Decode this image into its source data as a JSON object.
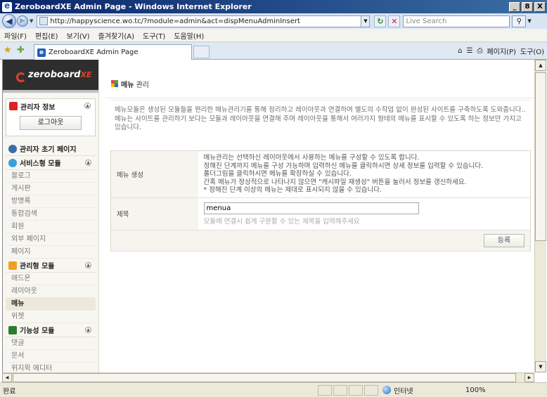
{
  "window": {
    "title": "ZeroboardXE Admin Page - Windows Internet Explorer",
    "minimize": "_",
    "maximize": "8",
    "close": "X"
  },
  "address": {
    "url": "http://happyscience.wo.tc/?module=admin&act=dispMenuAdminInsert",
    "search_placeholder": "Live Search"
  },
  "menu": [
    "파일(F)",
    "편집(E)",
    "보기(V)",
    "즐겨찾기(A)",
    "도구(T)",
    "도움말(H)"
  ],
  "tab": {
    "title": "ZeroboardXE Admin Page"
  },
  "commandbar": {
    "home": "⌂",
    "feeds": "☰",
    "print": "⎙",
    "page": "페이지(P)",
    "tools": "도구(O)"
  },
  "sidebar": {
    "logo": "zeroboard",
    "logo_suffix": "XE",
    "admin_info": "관리자 정보",
    "logout": "로그아웃",
    "admin_home": "관리자 초기 페이지",
    "service_modules": {
      "title": "서비스형 모듈",
      "items": [
        "블로그",
        "게시판",
        "방명록",
        "통합검색",
        "회원",
        "외부 페이지",
        "페이지"
      ]
    },
    "admin_modules": {
      "title": "관리형 모듈",
      "items": [
        "애드온",
        "레이아웃",
        "메뉴",
        "위젯"
      ]
    },
    "function_modules": {
      "title": "기능성 모듈",
      "items": [
        "댓글",
        "문서",
        "위지윅 에디터"
      ]
    }
  },
  "main": {
    "title_bold": "메뉴",
    "title_rest": " 관리",
    "desc_1": "메뉴모듈은 생성된 모듈들을 편리한 메뉴관리기를 통해 정리하고 레이아웃과 연결하여 별도의 수작업 없이 완성된 사이트를 구축하도록 도와줍니다..",
    "desc_2": "메뉴는 사이트를 관리하기 보다는 모듈과 레이아웃을 연결해 주며 레이아웃을 통해서 여러가지 형태의 메뉴를 표시할 수 있도록 하는 정보만 가지고 있습니다.",
    "row1_label": "메뉴 생성",
    "row1_lines": [
      "메뉴관리는 선택하신 레이아웃에서 사용하는 메뉴를 구성할 수 있도록 합니다.",
      "정해진 단계까지 메뉴를 구성 가능하며 입력하신 메뉴를 클릭하시면 상세 정보를 입력할 수 있습니다.",
      "폴더그림을 클릭하시면 메뉴를 확장하실 수 있습니다.",
      "간혹 메뉴가 정상적으로 나타나지 않으면 \"캐시파일 재생성\" 버튼을 눌러서 정보를 갱신하세요.",
      "* 정해진 단계 이상의 메뉴는 제대로 표시되지 않을 수 있습니다."
    ],
    "row2_label": "제목",
    "title_value": "menua",
    "title_hint": "모듈에 연결시 쉽게 구분할 수 있는 제목을 입력해주세요",
    "submit": "등록"
  },
  "status": {
    "text": "완료",
    "zone": "인터넷",
    "zoom": "100%"
  }
}
